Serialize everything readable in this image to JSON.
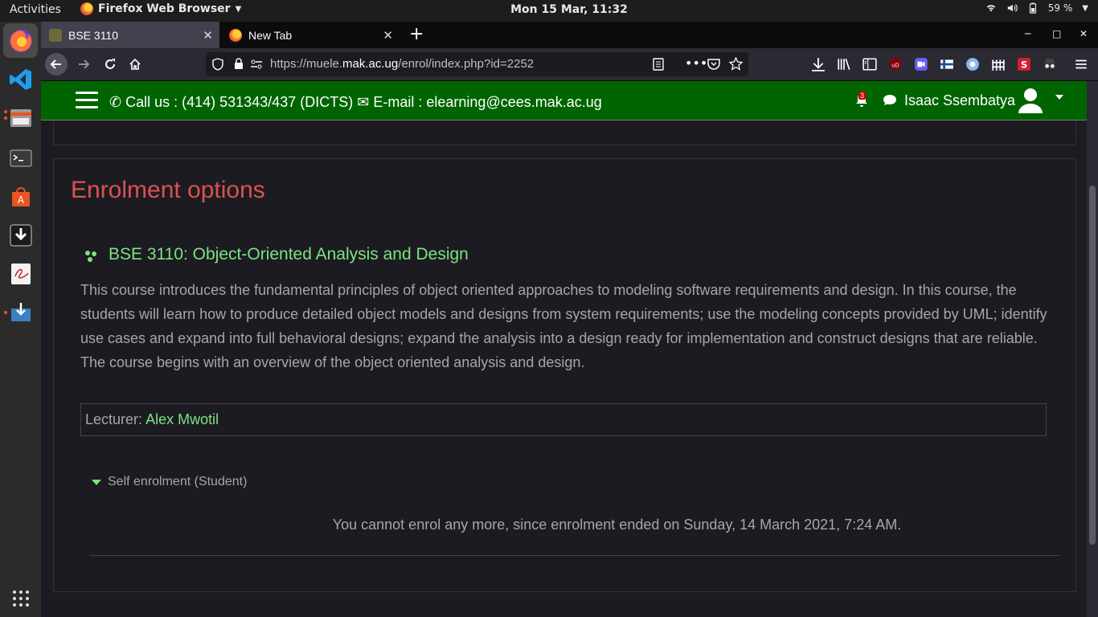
{
  "system": {
    "activities": "Activities",
    "app_name": "Firefox Web Browser",
    "clock": "Mon 15 Mar, 11:32",
    "battery": "59 %"
  },
  "browser": {
    "tabs": [
      {
        "label": "BSE 3110",
        "active": true
      },
      {
        "label": "New Tab",
        "active": false
      }
    ],
    "url_prefix": "https://muele.",
    "url_domain": "mak.ac.ug",
    "url_path": "/enrol/index.php?id=2252"
  },
  "site": {
    "call_text": "Call us : (414) 531343/437 (DICTS)",
    "email_text": "E-mail : elearning@cees.mak.ac.ug",
    "notifications_count": "3",
    "user_name": "Isaac Ssembatya",
    "nav_color": "#006400"
  },
  "page": {
    "title": "Enrolment options",
    "course_name": "BSE 3110: Object-Oriented Analysis and Design",
    "summary": "This course introduces the fundamental principles of object oriented approaches to modeling  software requirements and design. In this course, the students will learn how to produce detailed object models and designs from system requirements; use the modeling concepts provided by UML; identify use cases and expand into full behavioral designs; expand the analysis into a design ready for implementation and construct designs that are reliable. The course begins with an overview of the object oriented analysis and design.",
    "lecturer_label": "Lecturer:",
    "lecturer_name": "Alex Mwotil",
    "enrol_method": "Self enrolment (Student)",
    "enrol_message": "You cannot enrol any more, since enrolment ended on Sunday, 14 March 2021, 7:24 AM."
  }
}
